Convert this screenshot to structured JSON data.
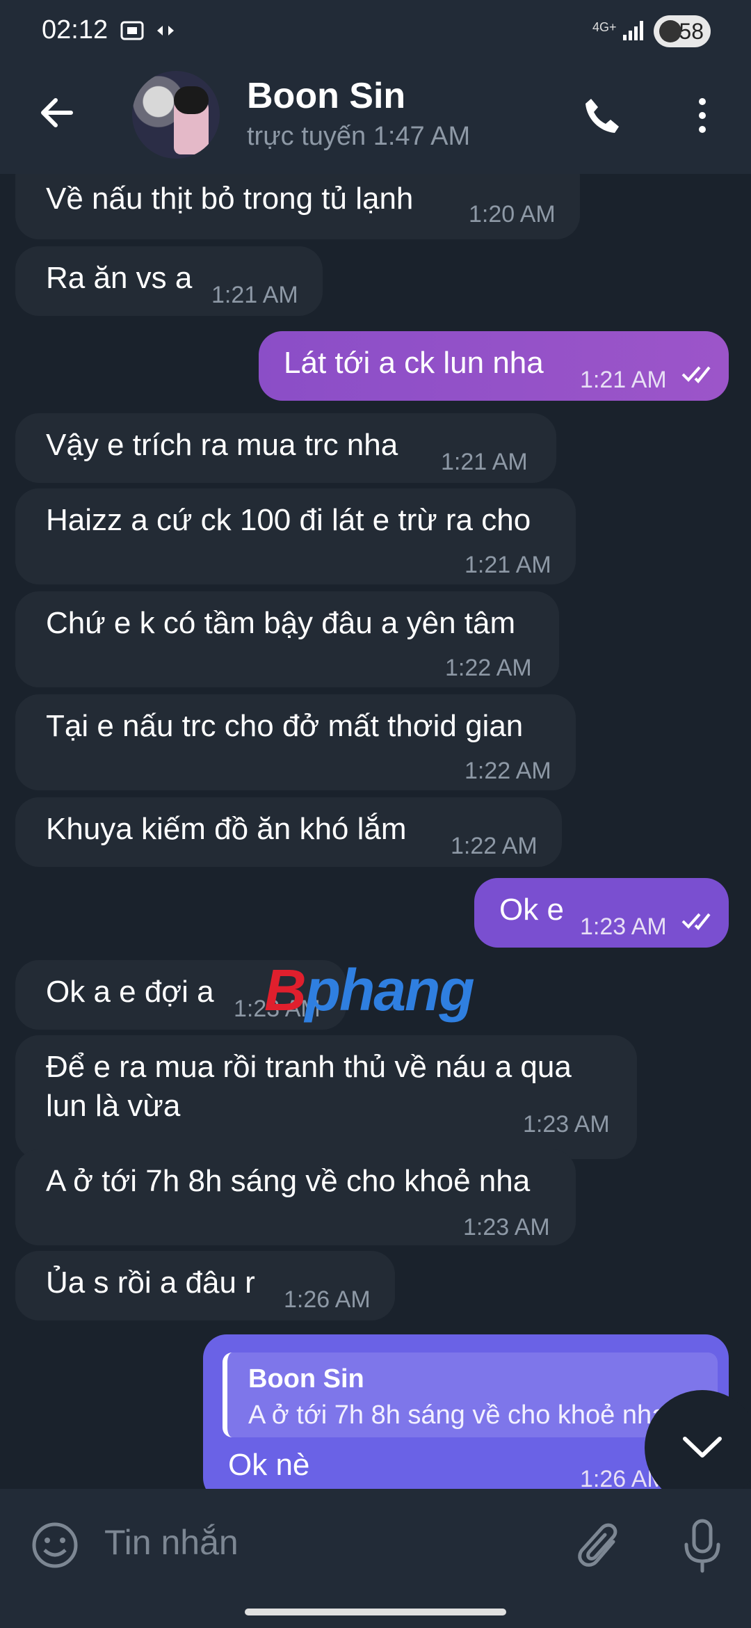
{
  "status_bar": {
    "time": "02:12",
    "network": "4G+",
    "battery": "58"
  },
  "header": {
    "contact_name": "Boon Sin",
    "contact_status": "trực tuyến 1:47 AM"
  },
  "messages": [
    {
      "dir": "in",
      "text": "Về nấu thịt bỏ trong tủ lạnh",
      "time": "1:20 AM"
    },
    {
      "dir": "in",
      "text": "Ra ăn vs a",
      "time": "1:21 AM"
    },
    {
      "dir": "out",
      "text": "Lát tới a ck lun nha",
      "time": "1:21 AM"
    },
    {
      "dir": "in",
      "text": "Vậy e trích ra mua trc nha",
      "time": "1:21 AM"
    },
    {
      "dir": "in",
      "text": "Haizz a cứ ck 100 đi lát e trừ ra cho",
      "time": "1:21 AM"
    },
    {
      "dir": "in",
      "text": "Chứ e k có tầm bậy đâu a yên tâm",
      "time": "1:22 AM"
    },
    {
      "dir": "in",
      "text": "Tại e nấu trc cho đở mất thơid gian",
      "time": "1:22 AM"
    },
    {
      "dir": "in",
      "text": "Khuya kiếm đồ ăn khó lắm",
      "time": "1:22 AM"
    },
    {
      "dir": "out",
      "text": "Ok e",
      "time": "1:23 AM"
    },
    {
      "dir": "in",
      "text": "Ok a e đợi a",
      "time": "1:23 AM"
    },
    {
      "dir": "in",
      "text_line1": "Để e ra mua rồi tranh thủ về náu a qua",
      "text_line2": "lun là vừa",
      "time": "1:23 AM"
    },
    {
      "dir": "in",
      "text": "A ở tới 7h 8h sáng về cho khoẻ nha",
      "time": "1:23 AM"
    },
    {
      "dir": "in",
      "text": "Ủa s rồi a đâu r",
      "time": "1:26 AM"
    },
    {
      "dir": "out",
      "reply_name": "Boon Sin",
      "reply_text": "A ở tới 7h 8h sáng về cho khoẻ nha",
      "text": "Ok nè",
      "time": "1:26 AM"
    }
  ],
  "watermark": {
    "part1": "B",
    "part2": "phang"
  },
  "composer": {
    "placeholder": "Tin nhắn"
  },
  "icons": [
    "back-arrow-icon",
    "phone-icon",
    "more-vert-icon",
    "emoji-icon",
    "attach-icon",
    "mic-icon",
    "chevron-down-icon",
    "double-check-icon"
  ],
  "colors": {
    "header_bg": "#222b37",
    "chat_bg": "#1a222c",
    "incoming_bubble": "#232b35",
    "outgoing_bubble": "#9c55c9",
    "reply_bubble": "#6a62e6"
  }
}
